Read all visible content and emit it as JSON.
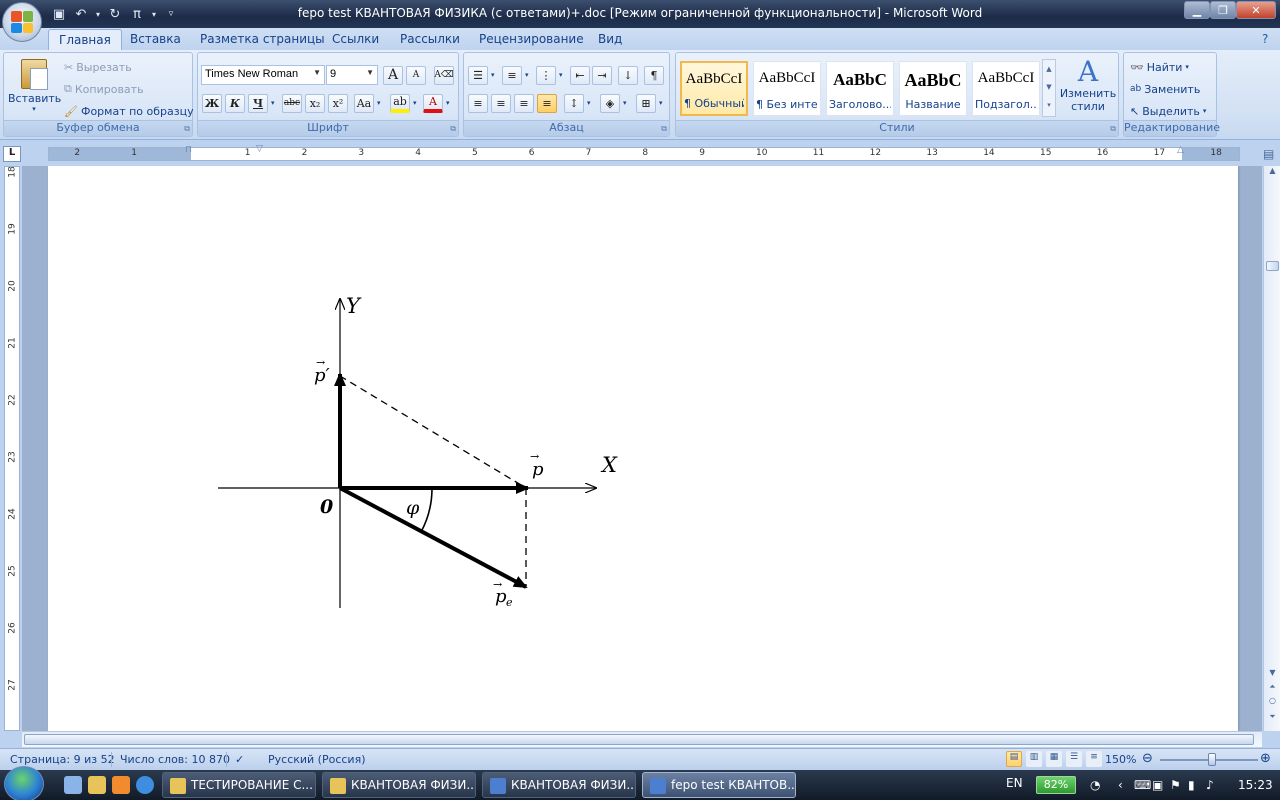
{
  "window": {
    "title": "fepo test КВАНТОВАЯ ФИЗИКА (с ответами)+.doc [Режим ограниченной функциональности]  -  Microsoft Word"
  },
  "ribbon": {
    "tabs": [
      "Главная",
      "Вставка",
      "Разметка страницы",
      "Ссылки",
      "Рассылки",
      "Рецензирование",
      "Вид"
    ],
    "active_tab": "Главная",
    "clipboard": {
      "paste": "Вставить",
      "cut": "Вырезать",
      "copy": "Копировать",
      "format_painter": "Формат по образцу",
      "label": "Буфер обмена"
    },
    "font": {
      "name": "Times New Roman",
      "size": "9",
      "bold": "Ж",
      "italic": "К",
      "underline": "Ч",
      "strike": "abc",
      "subscript": "x₂",
      "superscript": "x²",
      "case": "Aa",
      "grow": "A",
      "shrink": "A",
      "label": "Шрифт"
    },
    "paragraph": {
      "label": "Абзац",
      "show_marks": "¶"
    },
    "styles": {
      "items": [
        {
          "sample": "AaBbCcI",
          "name": "¶ Обычный"
        },
        {
          "sample": "AaBbCcI",
          "name": "¶ Без инте..."
        },
        {
          "sample": "AaBbC",
          "name": "Заголово..."
        },
        {
          "sample": "AaBbC",
          "name": "Название"
        },
        {
          "sample": "AaBbCcI",
          "name": "Подзагол..."
        }
      ],
      "change_styles": "Изменить стили",
      "label": "Стили"
    },
    "editing": {
      "find": "Найти",
      "replace": "Заменить",
      "select": "Выделить",
      "label": "Редактирование"
    }
  },
  "ruler": {
    "corner": "L",
    "h_ticks": [
      "2",
      "1",
      "1",
      "2",
      "3",
      "4",
      "5",
      "6",
      "7",
      "8",
      "9",
      "10",
      "11",
      "12",
      "13",
      "14",
      "15",
      "16",
      "17",
      "18"
    ],
    "v_ticks": [
      "18",
      "19",
      "20",
      "21",
      "22",
      "23",
      "24",
      "25",
      "26",
      "27"
    ]
  },
  "figure": {
    "label_y": "Y",
    "label_x": "X",
    "label_origin": "0",
    "label_p_prime": "p′",
    "label_p": "p",
    "label_pe": "p",
    "label_pe_sub": "e",
    "label_phi": "φ"
  },
  "status": {
    "page": "Страница: 9 из 52",
    "words": "Число слов: 10 870",
    "language": "Русский (Россия)",
    "zoom": "150%"
  },
  "taskbar": {
    "tasks": [
      "ТЕСТИРОВАНИЕ С...",
      "КВАНТОВАЯ ФИЗИ...",
      "КВАНТОВАЯ ФИЗИ...",
      "fepo test КВАНТОВ..."
    ],
    "lang": "EN",
    "battery": "82%",
    "clock": "15:23"
  }
}
